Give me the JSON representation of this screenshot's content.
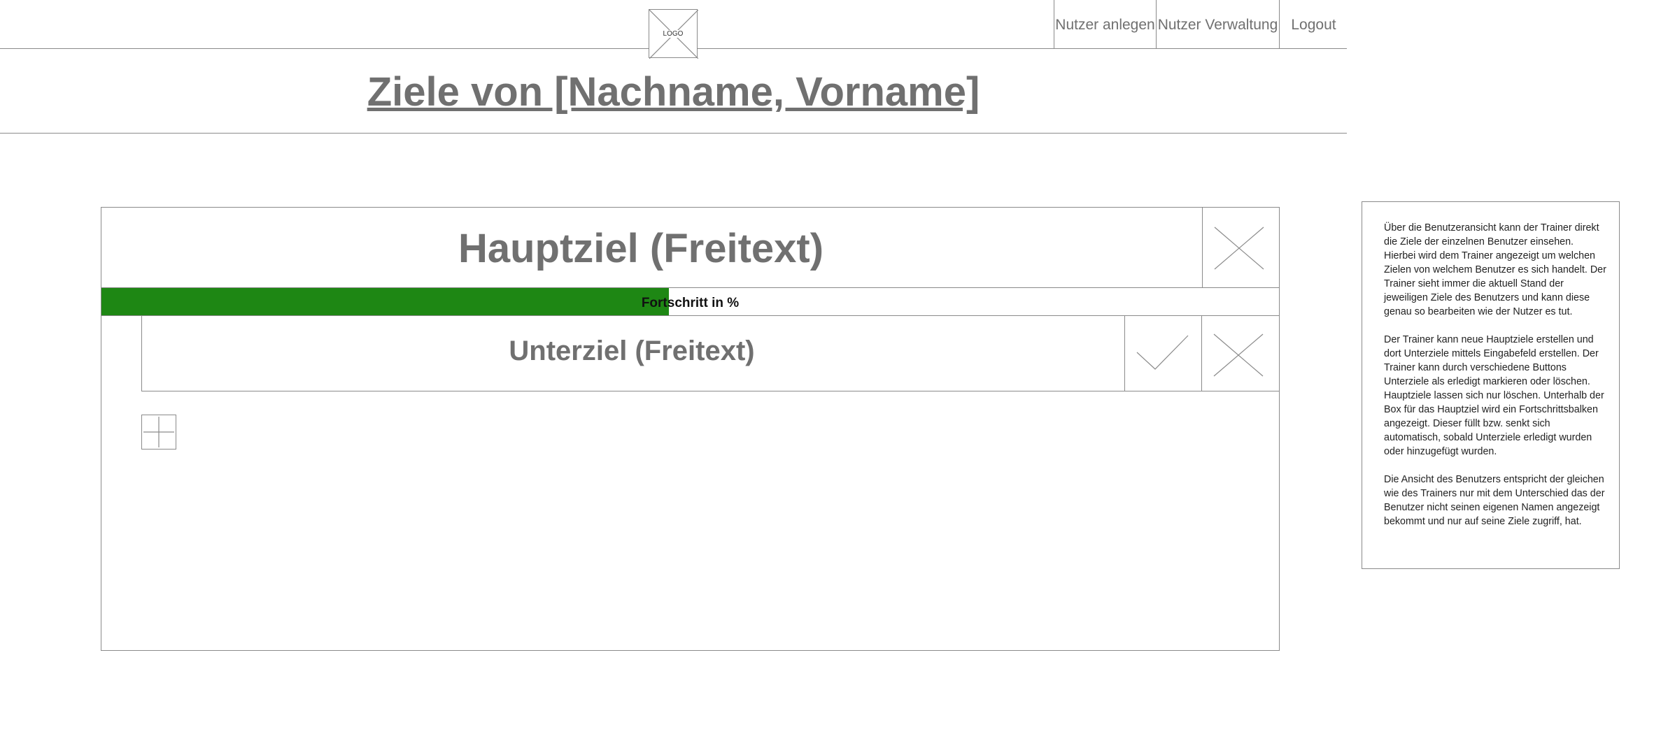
{
  "header": {
    "logo_text": "LOGO",
    "nav": [
      {
        "label": "Nutzer anlegen"
      },
      {
        "label": "Nutzer Verwaltung"
      },
      {
        "label": "Logout"
      }
    ]
  },
  "page_title": "Ziele von [Nachname, Vorname]",
  "main_goal": {
    "title": "Hauptziel (Freitext)",
    "progress_label": "Fortschritt in %",
    "progress_fraction": 0.482,
    "progress_color": "#1e8714",
    "sub_goals": [
      {
        "title": "Unterziel (Freitext)"
      }
    ]
  },
  "icons": {
    "delete": "close-icon",
    "complete": "checkmark-icon",
    "add": "plus-icon",
    "logo": "logo-placeholder-icon"
  },
  "note": {
    "paragraphs": [
      "Über die Benutzeransicht kann der Trainer direkt die Ziele der einzelnen Benutzer einsehen. Hierbei wird dem Trainer angezeigt um welchen Zielen von welchem Benutzer es sich handelt. Der Trainer sieht immer die aktuell Stand der jeweiligen Ziele des Benutzers und kann diese genau so bearbeiten wie der Nutzer es tut.",
      "Der Trainer kann neue Hauptziele erstellen und dort Unterziele mittels Eingabefeld erstellen. Der Trainer kann durch verschiedene Buttons Unterziele als erledigt markieren oder löschen. Hauptziele lassen sich nur löschen. Unterhalb der Box für das Hauptziel wird ein Fortschrittsbalken angezeigt. Dieser füllt bzw. senkt sich automatisch, sobald Unterziele erledigt wurden oder hinzugefügt wurden.",
      "Die Ansicht des Benutzers entspricht der gleichen wie des Trainers nur mit dem Unterschied das der Benutzer nicht seinen eigenen Namen angezeigt bekommt und nur auf seine Ziele zugriff, hat."
    ]
  }
}
